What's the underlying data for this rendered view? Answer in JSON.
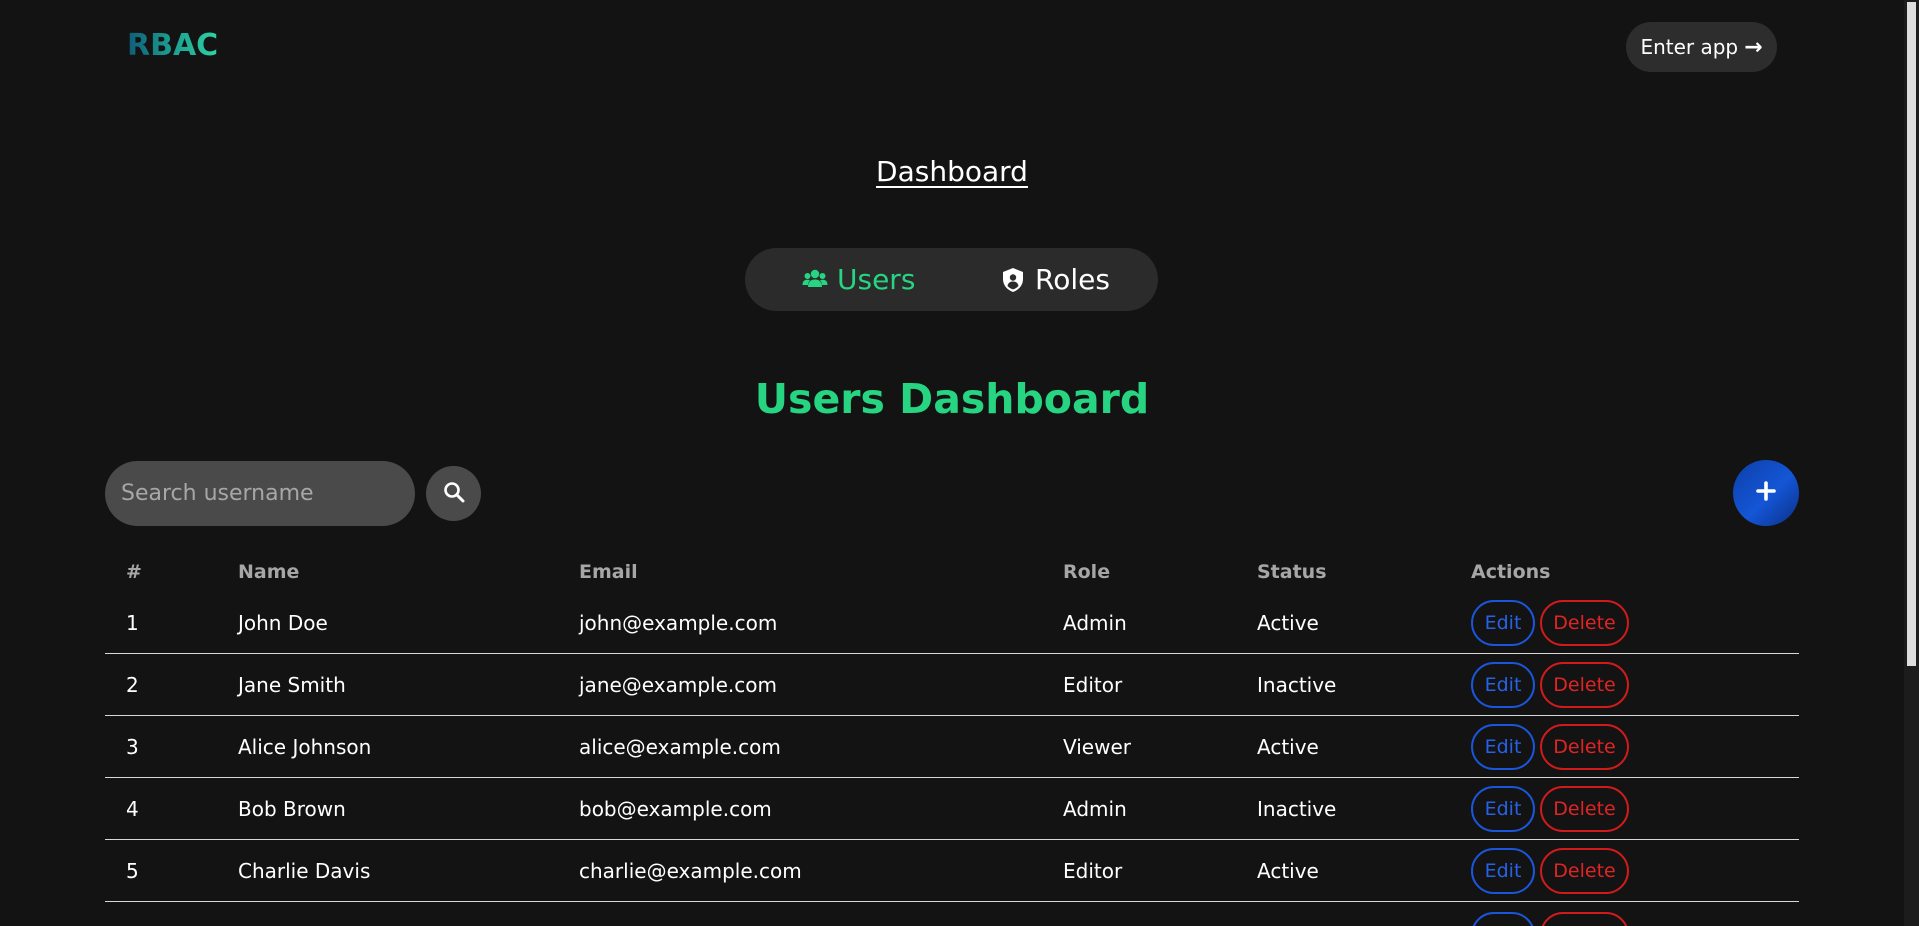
{
  "header": {
    "logo": "RBAC",
    "enter_label": "Enter app",
    "enter_arrow": "→"
  },
  "nav": {
    "dashboard_link": "Dashboard"
  },
  "tabs": [
    {
      "label": "Users",
      "icon": "users-icon",
      "active": true
    },
    {
      "label": "Roles",
      "icon": "shield-user-icon",
      "active": false
    }
  ],
  "main": {
    "heading": "Users Dashboard",
    "search": {
      "placeholder": "Search username",
      "value": ""
    },
    "add_label": "+"
  },
  "table": {
    "columns": [
      "#",
      "Name",
      "Email",
      "Role",
      "Status",
      "Actions"
    ],
    "rows": [
      {
        "num": "1",
        "name": "John Doe",
        "email": "john@example.com",
        "role": "Admin",
        "status": "Active"
      },
      {
        "num": "2",
        "name": "Jane Smith",
        "email": "jane@example.com",
        "role": "Editor",
        "status": "Inactive"
      },
      {
        "num": "3",
        "name": "Alice Johnson",
        "email": "alice@example.com",
        "role": "Viewer",
        "status": "Active"
      },
      {
        "num": "4",
        "name": "Bob Brown",
        "email": "bob@example.com",
        "role": "Admin",
        "status": "Inactive"
      },
      {
        "num": "5",
        "name": "Charlie Davis",
        "email": "charlie@example.com",
        "role": "Editor",
        "status": "Active"
      }
    ],
    "edit_label": "Edit",
    "delete_label": "Delete"
  },
  "colors": {
    "background": "#131313",
    "accent_green": "#26d481",
    "edit_blue": "#1a56db",
    "delete_red": "#d01b1b",
    "add_button": "#1456d6"
  }
}
